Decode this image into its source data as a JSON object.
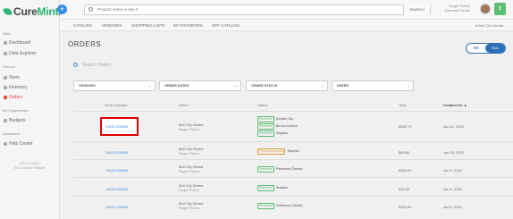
{
  "app": {
    "brand_main": "Cure",
    "brand_accent": "Mint",
    "brand_suffix": ".",
    "brand_color": "#2bb673",
    "plus_label": "+"
  },
  "sidebar": {
    "sections": [
      {
        "label": "Data",
        "items": [
          {
            "label": "Dashboard",
            "icon": "dashboard-icon"
          },
          {
            "label": "Data Explorer",
            "icon": "chart-icon"
          }
        ]
      },
      {
        "label": "Procure",
        "items": [
          {
            "label": "Store",
            "icon": "store-icon"
          },
          {
            "label": "Inventory",
            "icon": "inventory-icon"
          },
          {
            "label": "Orders",
            "icon": "orders-icon",
            "active": true
          }
        ]
      },
      {
        "label": "My Organization",
        "items": [
          {
            "label": "Budgets",
            "icon": "budget-icon"
          }
        ]
      },
      {
        "label": "Assistance",
        "items": [
          {
            "label": "Help Center",
            "icon": "help-icon"
          }
        ]
      }
    ],
    "footer_line1": "2023 CureMint",
    "footer_line2": "The Complete Platform"
  },
  "topbar": {
    "search_placeholder": "Product name or sku #",
    "search_button": "SEARCH",
    "user_name": "Roger Pierce",
    "user_org": "Dunham Dental",
    "badge": "5"
  },
  "subnav": {
    "tabs": [
      "CATALOG",
      "VENDORS",
      "SHOPPING LISTS",
      "MY FAVORITES",
      "OFF CATALOG"
    ],
    "location": "Bull City Dental"
  },
  "main": {
    "title": "ORDERS",
    "toggle_me": "ME",
    "toggle_all": "ALL",
    "search_placeholder": "Search Orders",
    "filters": [
      "VENDORS",
      "ORDER DATES",
      "ORDER STATUS",
      "USERS"
    ],
    "columns": [
      "Order Number",
      "Office ↕",
      "Status",
      "Total",
      "Created On ▲"
    ],
    "rows": [
      {
        "order": "CM10-205656",
        "office": "Bull City Dental",
        "user": "Roger Pierce",
        "statuses": [
          {
            "tag": "Received",
            "vendor": "Dental City"
          },
          {
            "tag": "Received",
            "vendor": "Benco Dental"
          },
          {
            "tag": "Received",
            "vendor": "Staples"
          }
        ],
        "total": "$282.73",
        "date": "Jun 21, 2022"
      },
      {
        "order": "CM10-205654",
        "office": "Bull City Dental",
        "user": "Roger Pierce",
        "statuses": [
          {
            "tag": "Pending Approval",
            "vendor": "Staples",
            "pending": true
          }
        ],
        "total": "$48.80",
        "date": "Jun 13, 2022"
      },
      {
        "order": "CM10-205644",
        "office": "Bull City Dental",
        "user": "Roger Pierce",
        "statuses": [
          {
            "tag": "Received",
            "vendor": "Patterson Dental"
          }
        ],
        "total": "$320.00",
        "date": "Jun 9, 2022"
      },
      {
        "order": "CM10-205643",
        "office": "Bull City Dental",
        "user": "Roger Pierce",
        "statuses": [
          {
            "tag": "Received",
            "vendor": "Staples"
          }
        ],
        "total": "$32.00",
        "date": "Jun 9, 2022"
      },
      {
        "order": "CM10-205642",
        "office": "Bull City Dental",
        "user": "Roger Pierce",
        "statuses": [
          {
            "tag": "Received",
            "vendor": "Patterson Dental"
          }
        ],
        "total": "$320.00",
        "date": "Jun 9, 2022"
      }
    ]
  }
}
